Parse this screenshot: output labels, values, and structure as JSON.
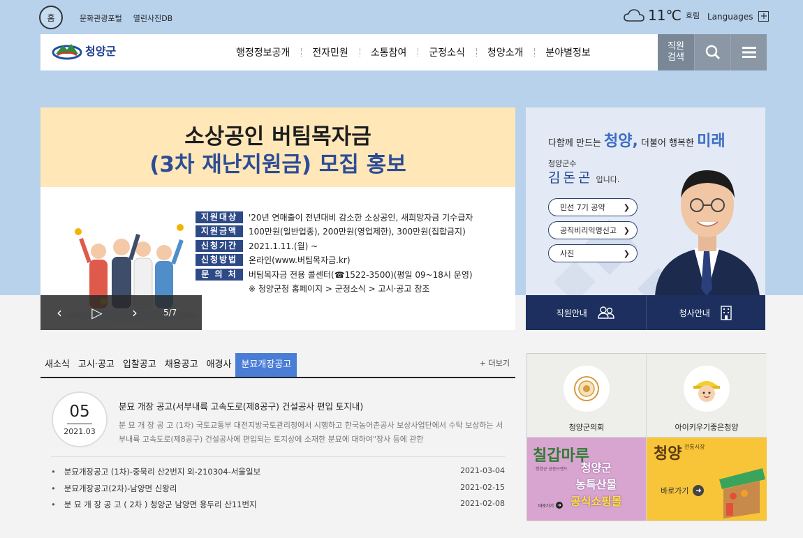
{
  "header": {
    "home_label": "홈",
    "util_links": [
      "문화관광포털",
      "열린사진DB"
    ],
    "weather": {
      "temp": "11℃",
      "desc": "흐림"
    },
    "languages_label": "Languages"
  },
  "nav": {
    "logo_text": "청양군",
    "menu": [
      "행정정보공개",
      "전자민원",
      "소통참여",
      "군정소식",
      "청양소개",
      "분야별정보"
    ],
    "staff_search_label": "직원\n검색"
  },
  "banner": {
    "title_line1": "소상공인 버팀목자금",
    "title_line2": "(3차 재난지원금) 모집 홍보",
    "rows": [
      {
        "tag": "지원대상",
        "value": "'20년 연매출이 전년대비 감소한 소상공인, 새희망자금 기수급자"
      },
      {
        "tag": "지원금액",
        "value": "100만원(일반업종), 200만원(영업제한), 300만원(집합금지)"
      },
      {
        "tag": "신청기간",
        "value": "2021.1.11.(월) ~"
      },
      {
        "tag": "신청방법",
        "value": "온라인(www.버팀목자금.kr)"
      },
      {
        "tag": "문 의 처",
        "value": "버팀목자금 전용 콜센터(☎1522-3500)(평일 09~18시 운영)"
      }
    ],
    "note": "※ 청양군청 홈페이지 > 군정소식 > 고시·공고 참조",
    "page": "5/7"
  },
  "governor": {
    "slogan_pre": "다함께 만드는",
    "slogan_w1": "청양,",
    "slogan_mid": "더불어 행복한",
    "slogan_w2": "미래",
    "role": "청양군수",
    "name": "김돈곤",
    "name_suffix": "입니다.",
    "links": [
      "민선 7기 공약",
      "공직비리익명신고",
      "사진"
    ],
    "bottom_tabs": [
      "직원안내",
      "청사안내"
    ]
  },
  "notice": {
    "tabs": [
      "새소식",
      "고시·공고",
      "입찰공고",
      "채용공고",
      "애경사",
      "분묘개장공고"
    ],
    "more_label": "+ 더보기",
    "feature": {
      "day": "05",
      "ym": "2021.03",
      "title": "분묘 개장 공고(서부내륙 고속도로(제8공구) 건설공사 편입 토지내)",
      "body": "분 묘 개 장 공 고 (1차) 국토교통부 대전지방국토관리청에서 시행하고 한국농어촌공사 보상사업단에서 수탁 보상하는 서부내륙 고속도로(제8공구) 건설공사에 편입되는 토지상에 소재한 분묘에 대하여\"장사 등에 관한"
    },
    "items": [
      {
        "title": "분묘개장공고 (1차)-중묵리 산2번지 외-210304-서울일보",
        "date": "2021-03-04"
      },
      {
        "title": "분묘개장공고(2차)-남양면 신왕리",
        "date": "2021-02-15"
      },
      {
        "title": "분 묘 개 장 공 고 ( 2차 ) 청양군 남양면 용두리 산11번지",
        "date": "2021-02-08"
      }
    ]
  },
  "quick": {
    "council_label": "청양군의회",
    "kids_label": "아이키우기좋은청양",
    "shop": {
      "script": "칠갑마루",
      "sub": "청양군 공동브랜드",
      "line1": "청양군",
      "line2": "농특산물",
      "line3": "공식쇼핑몰",
      "go": "바로가기"
    },
    "market": {
      "script": "청양",
      "sub": "전통시장",
      "go": "바로가기"
    }
  },
  "colors": {
    "sky": "#b8d2ec",
    "navy": "#1c2f5e",
    "accent_blue": "#4a7dd6",
    "banner_yellow": "#ffe7b8"
  }
}
